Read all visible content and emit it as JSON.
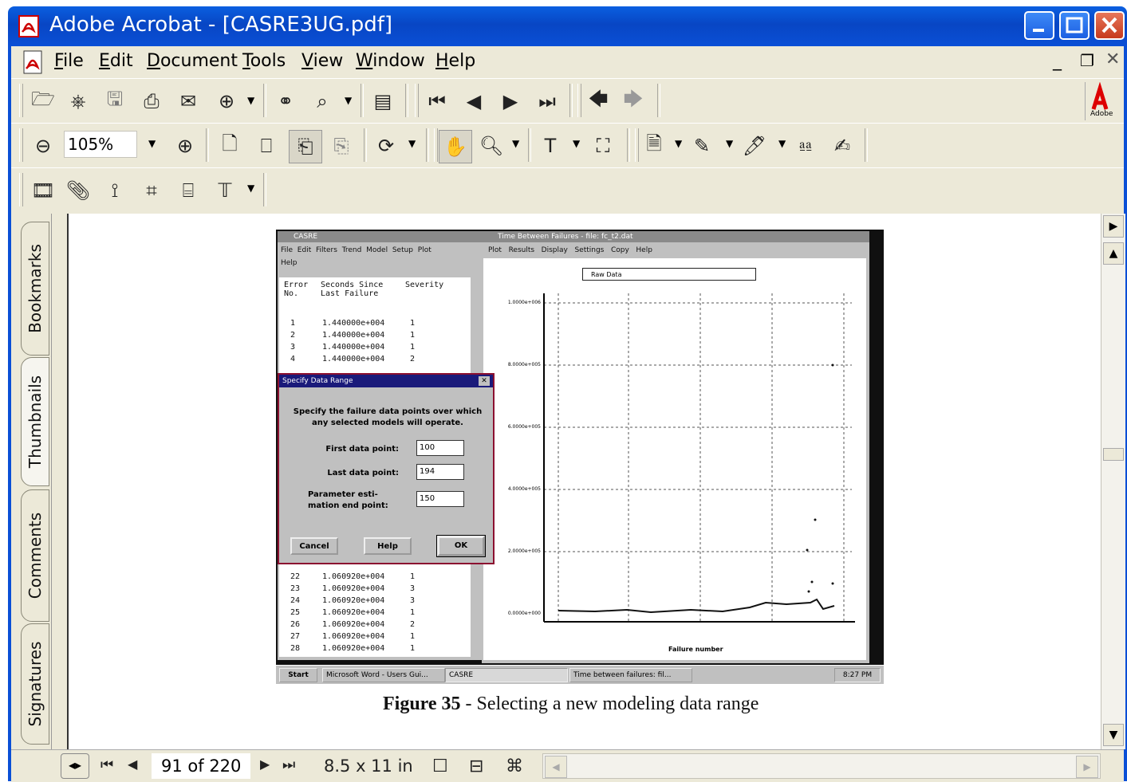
{
  "window": {
    "title": "Adobe Acrobat - [CASRE3UG.pdf]"
  },
  "menu": {
    "items": [
      {
        "pre": "",
        "u": "F",
        "post": "ile"
      },
      {
        "pre": "",
        "u": "E",
        "post": "dit"
      },
      {
        "pre": "",
        "u": "D",
        "post": "ocument"
      },
      {
        "pre": "",
        "u": "T",
        "post": "ools"
      },
      {
        "pre": "",
        "u": "V",
        "post": "iew"
      },
      {
        "pre": "",
        "u": "W",
        "post": "indow"
      },
      {
        "pre": "",
        "u": "H",
        "post": "elp"
      }
    ]
  },
  "toolbar": {
    "zoom_value": "105%"
  },
  "navpane": {
    "tabs": [
      "Bookmarks",
      "Thumbnails",
      "Comments",
      "Signatures"
    ]
  },
  "statusbar": {
    "page_indicator": "91 of 220",
    "page_size": "8.5 x 11 in"
  },
  "document": {
    "caption_label": "Figure 35",
    "caption_text": " - Selecting a new modeling data range",
    "screenshot": {
      "casre_title": "CASRE",
      "casre_menu": [
        "File",
        "Edit",
        "Filters",
        "Trend",
        "Model",
        "Setup",
        "Plot",
        "Help"
      ],
      "casre_headers": [
        "Error No.",
        "Seconds Since Last Failure",
        "Severity"
      ],
      "rows_top": [
        [
          "1",
          "1.440000e+004",
          "1"
        ],
        [
          "2",
          "1.440000e+004",
          "1"
        ],
        [
          "3",
          "1.440000e+004",
          "1"
        ],
        [
          "4",
          "1.440000e+004",
          "2"
        ]
      ],
      "rows_bottom": [
        [
          "22",
          "1.060920e+004",
          "1"
        ],
        [
          "23",
          "1.060920e+004",
          "3"
        ],
        [
          "24",
          "1.060920e+004",
          "3"
        ],
        [
          "25",
          "1.060920e+004",
          "1"
        ],
        [
          "26",
          "1.060920e+004",
          "2"
        ],
        [
          "27",
          "1.060920e+004",
          "1"
        ],
        [
          "28",
          "1.060920e+004",
          "1"
        ]
      ],
      "plot_title": "Time Between Failures - file: fc_t2.dat",
      "plot_menu": [
        "Plot",
        "Results",
        "Display",
        "Settings",
        "Copy",
        "Help"
      ],
      "legend": "Raw Data",
      "y_ticks": [
        "1.0000e+006",
        "8.0000e+005",
        "6.0000e+005",
        "4.0000e+005",
        "2.0000e+005",
        "0.0000e+000"
      ],
      "x_label": "Failure number",
      "dialog_title": "Specify Data Range",
      "dialog_text": "Specify the failure data points over which any selected models will operate.",
      "first_label": "First data point:",
      "first_value": "100",
      "last_label": "Last data point:",
      "last_value": "194",
      "param_label": "Parameter esti-mation end point:",
      "param_value": "150",
      "btn_cancel": "Cancel",
      "btn_help": "Help",
      "btn_ok": "OK",
      "taskbar_start": "Start",
      "taskbar_items": [
        "Microsoft Word - Users Gui...",
        "CASRE",
        "Time between failures: fil..."
      ],
      "taskbar_time": "8:27 PM"
    }
  }
}
